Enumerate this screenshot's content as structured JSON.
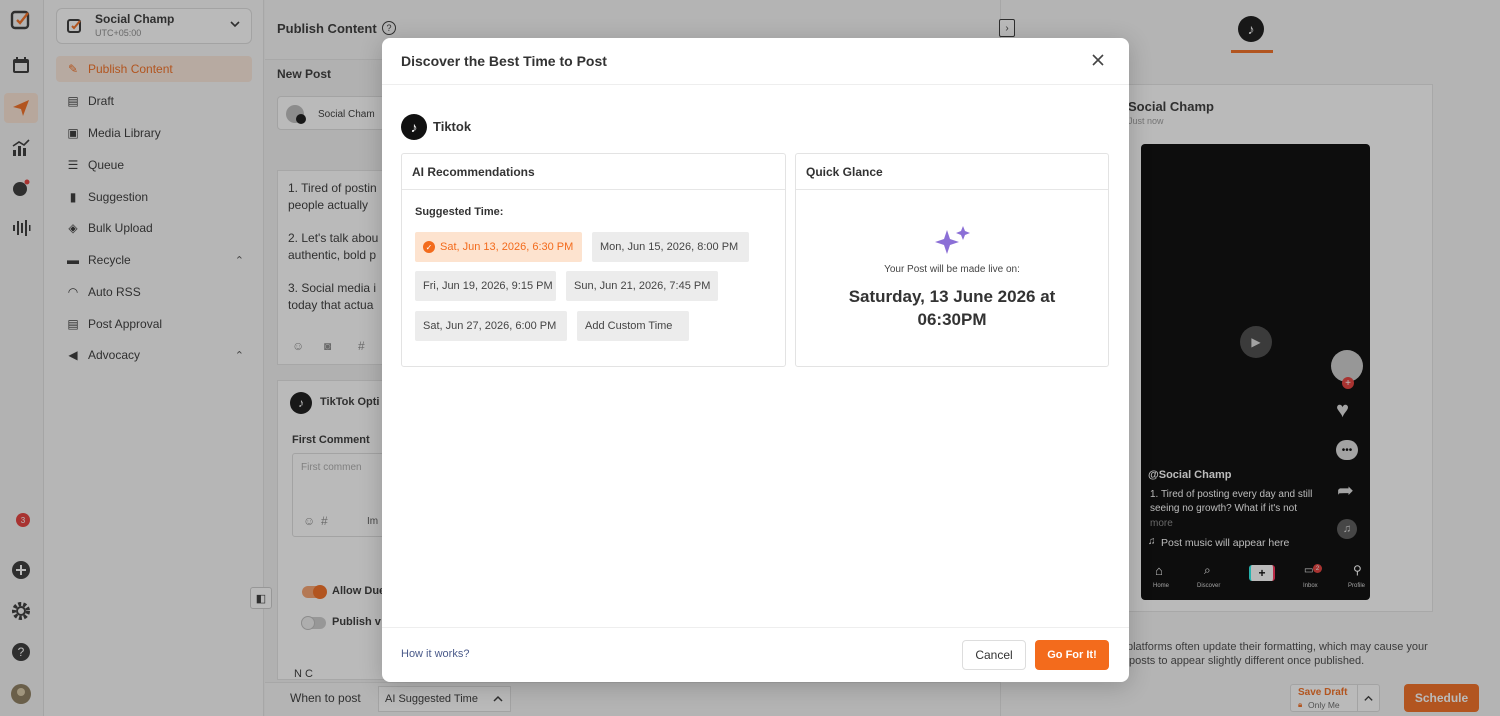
{
  "app": {
    "name": "Social Champ",
    "brand_color": "#f36b1c"
  },
  "account": {
    "name": "Social Champ",
    "timezone": "UTC+05:00"
  },
  "iconbar": {
    "items": [
      "logo-icon",
      "calendar-icon",
      "send-icon",
      "analytics-icon",
      "engage-icon",
      "listening-icon"
    ],
    "notification_count": "3"
  },
  "sidebar": {
    "items": [
      {
        "label": "Publish Content",
        "icon": "pencil-icon",
        "active": true
      },
      {
        "label": "Draft",
        "icon": "draft-icon"
      },
      {
        "label": "Media Library",
        "icon": "media-icon"
      },
      {
        "label": "Queue",
        "icon": "queue-icon"
      },
      {
        "label": "Suggestion",
        "icon": "bookmark-icon"
      },
      {
        "label": "Bulk Upload",
        "icon": "layers-icon"
      },
      {
        "label": "Recycle",
        "icon": "recycle-icon"
      },
      {
        "label": "Auto RSS",
        "icon": "rss-icon"
      },
      {
        "label": "Post Approval",
        "icon": "approval-icon"
      },
      {
        "label": "Advocacy",
        "icon": "megaphone-icon"
      }
    ]
  },
  "main": {
    "title": "Publish Content",
    "new_post": "New Post",
    "account_chip": "Social Cham",
    "post_lines": [
      "1. Tired of postin",
      "people actually",
      "2. Let's talk abou",
      "authentic, bold p",
      "3. Social media i",
      "today that actua"
    ],
    "tiktok_options": "TikTok Opti",
    "first_comment": "First Comment",
    "first_comment_placeholder": "First commen",
    "insert_label": "Im",
    "allow_duet": "Allow Due",
    "publish_v": "Publish v",
    "no_connected": "N  C",
    "when_to_post": "When to post",
    "ai_suggested_time": "AI Suggested Time"
  },
  "preview": {
    "name": "Social Champ",
    "time": "Just now",
    "handle": "@Social Champ",
    "caption_1": "1. Tired of posting every day and still",
    "caption_2": "seeing no growth? What if it's not",
    "more": "more",
    "music": "Post music will appear here",
    "nav": [
      "Home",
      "Discover",
      "",
      "Inbox",
      "Profile"
    ],
    "inbox_badge": "2",
    "notice_1": "platforms often update their formatting, which may cause your",
    "notice_2": "posts to appear slightly different once published."
  },
  "footer": {
    "save_draft": "Save Draft",
    "only_me": "Only Me",
    "schedule": "Schedule"
  },
  "modal": {
    "title": "Discover the Best Time to Post",
    "platform": "Tiktok",
    "ai_title": "AI Recommendations",
    "suggested_label": "Suggested Time:",
    "times": [
      {
        "label": "Sat, Jun 13, 2026, 6:30 PM",
        "selected": true
      },
      {
        "label": "Mon, Jun 15, 2026, 8:00 PM",
        "selected": false
      },
      {
        "label": "Fri, Jun 19, 2026, 9:15 PM",
        "selected": false
      },
      {
        "label": "Sun, Jun 21, 2026, 7:45 PM",
        "selected": false
      },
      {
        "label": "Sat, Jun 27, 2026, 6:00 PM",
        "selected": false
      },
      {
        "label": "Add Custom Time",
        "selected": false
      }
    ],
    "glance_title": "Quick Glance",
    "live_on": "Your Post will be made live on:",
    "live_date_1": "Saturday, 13 June 2026 at",
    "live_date_2": "06:30PM",
    "how_it_works": "How it works?",
    "cancel": "Cancel",
    "go": "Go For It!",
    "sparkle_color": "#8b6fd6"
  }
}
